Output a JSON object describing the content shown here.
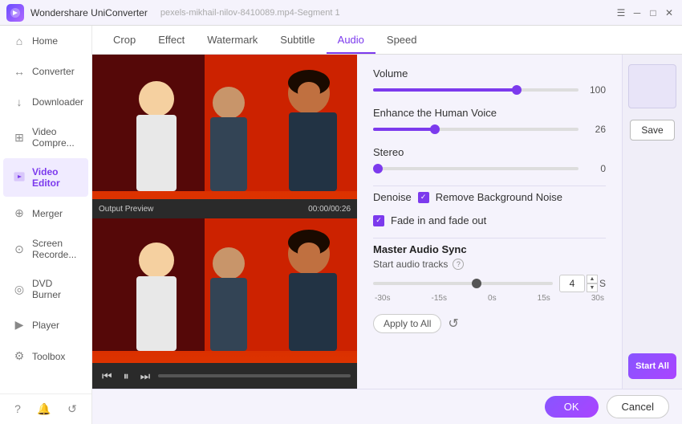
{
  "app": {
    "logo": "W",
    "title": "Wondershare UniConverter",
    "window_title": "pexels-mikhail-nilov-8410089.mp4-Segment 1"
  },
  "window_controls": {
    "menu": "☰",
    "minimize": "─",
    "maximize": "□",
    "close": "✕"
  },
  "sidebar": {
    "items": [
      {
        "id": "home",
        "label": "Home",
        "icon": "⌂"
      },
      {
        "id": "converter",
        "label": "Converter",
        "icon": "↔"
      },
      {
        "id": "downloader",
        "label": "Downloader",
        "icon": "↓"
      },
      {
        "id": "video-compressor",
        "label": "Video Compre...",
        "icon": "⊞"
      },
      {
        "id": "video-editor",
        "label": "Video Editor",
        "icon": "✦",
        "active": true
      },
      {
        "id": "merger",
        "label": "Merger",
        "icon": "⊕"
      },
      {
        "id": "screen-recorder",
        "label": "Screen Recorde...",
        "icon": "⊙"
      },
      {
        "id": "dvd-burner",
        "label": "DVD Burner",
        "icon": "◎"
      },
      {
        "id": "player",
        "label": "Player",
        "icon": "▶"
      },
      {
        "id": "toolbox",
        "label": "Toolbox",
        "icon": "⚙"
      }
    ],
    "bottom_icons": [
      "?",
      "🔔",
      "↺"
    ]
  },
  "tabs": [
    {
      "id": "crop",
      "label": "Crop"
    },
    {
      "id": "effect",
      "label": "Effect"
    },
    {
      "id": "watermark",
      "label": "Watermark"
    },
    {
      "id": "subtitle",
      "label": "Subtitle"
    },
    {
      "id": "audio",
      "label": "Audio",
      "active": true
    },
    {
      "id": "speed",
      "label": "Speed"
    }
  ],
  "audio_settings": {
    "volume": {
      "label": "Volume",
      "value": 100,
      "fill_pct": 70
    },
    "enhance": {
      "label": "Enhance the Human Voice",
      "value": 26,
      "fill_pct": 30
    },
    "stereo": {
      "label": "Stereo",
      "value": 0,
      "fill_pct": 0
    },
    "denoise": {
      "label": "Denoise",
      "remove_bg_label": "Remove Background Noise",
      "remove_bg_checked": true
    },
    "fade": {
      "label": "Fade in and fade out",
      "checked": true
    },
    "master_sync": {
      "title": "Master Audio Sync",
      "sub_label": "Start audio tracks",
      "timeline_labels": [
        "-30s",
        "-15s",
        "0s",
        "15s",
        "30s"
      ],
      "value": 4,
      "unit": "S",
      "thumb_left_pct": 55
    }
  },
  "buttons": {
    "apply_all": "Apply to All",
    "ok": "OK",
    "cancel": "Cancel",
    "save": "Save",
    "start_all": "Start All"
  },
  "video": {
    "preview_label": "Output Preview",
    "time": "00:00/00:26"
  }
}
